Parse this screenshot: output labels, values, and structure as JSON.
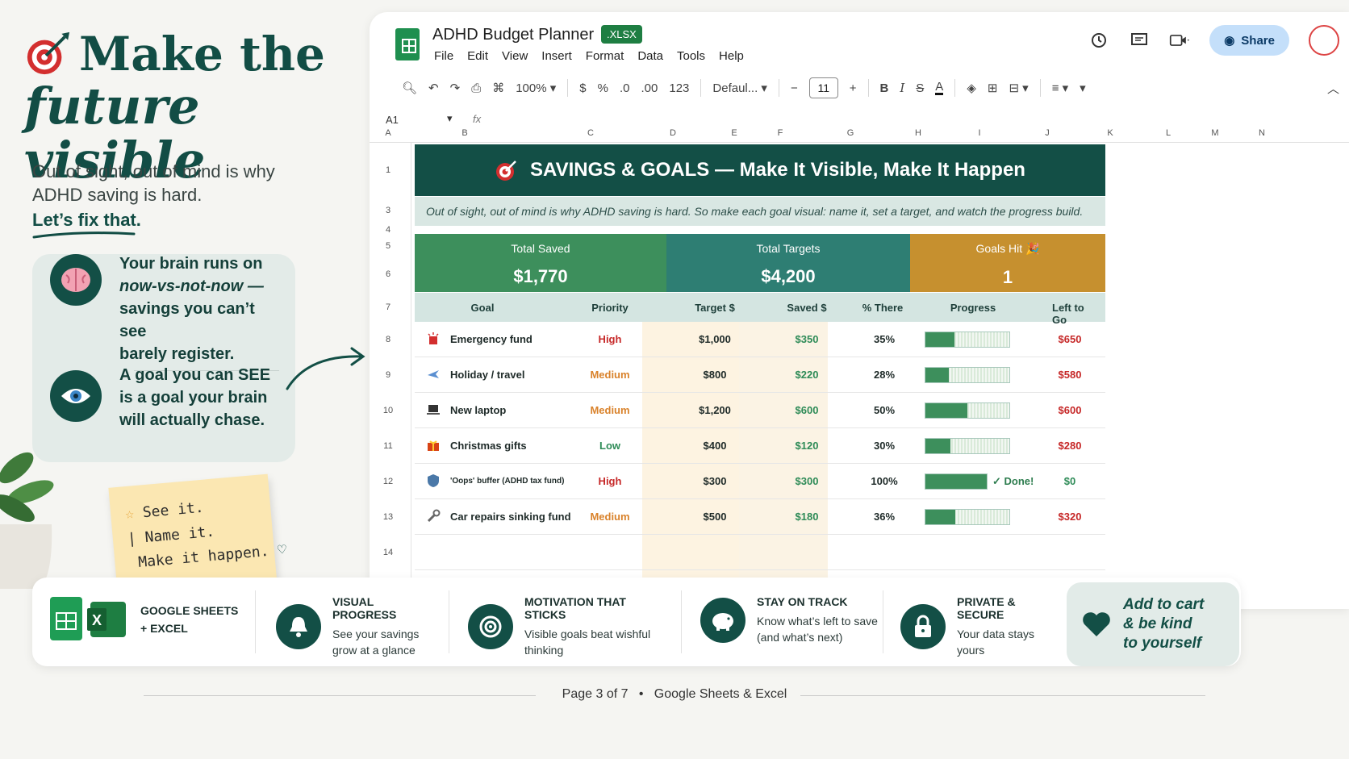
{
  "hero": {
    "title_line1": "Make the",
    "title_line2": "future visible",
    "subtitle": "Out of sight, out of mind is why ADHD saving is hard.",
    "fix": "Let’s fix that."
  },
  "brain_card": {
    "point1_line1": "Your brain runs on",
    "point1_line2": "now-vs-not-now —",
    "point1_line3": "savings you can’t see",
    "point1_line4": "barely register.",
    "point2_line1": "A goal you can SEE",
    "point2_line2": "is a goal your brain",
    "point2_line3": "will actually chase."
  },
  "sticky": {
    "line1": "See it.",
    "line2": "Name it.",
    "line3": "Make it happen."
  },
  "app": {
    "doc_title": "ADHD Budget Planner",
    "badge": ".XLSX",
    "menu": [
      "File",
      "Edit",
      "View",
      "Insert",
      "Format",
      "Data",
      "Tools",
      "Help"
    ],
    "share_label": "Share",
    "toolbar": {
      "zoom": "100%",
      "currency": "$",
      "percent": "%",
      "dec_less": ".0",
      "dec_more": ".00",
      "number_format": "123",
      "font": "Defaul...",
      "font_size": "11"
    },
    "cell_ref": "A1",
    "fx": "fx"
  },
  "columns": [
    "A",
    "B",
    "C",
    "D",
    "E",
    "F",
    "G",
    "H",
    "I",
    "J",
    "K",
    "L",
    "M",
    "N"
  ],
  "rows": [
    "1",
    "3",
    "4",
    "5",
    "6",
    "7",
    "8",
    "9",
    "10",
    "11",
    "12",
    "13",
    "14"
  ],
  "sheet": {
    "banner": "SAVINGS & GOALS — Make It Visible, Make It Happen",
    "subline": "Out of sight, out of mind is why ADHD saving is hard. So make each goal visual: name it, set a target, and watch the progress build.",
    "kpis": [
      {
        "label": "Total Saved",
        "value": "$1,770"
      },
      {
        "label": "Total Targets",
        "value": "$4,200"
      },
      {
        "label": "Goals Hit 🎉",
        "value": "1"
      }
    ],
    "headers": [
      "Goal",
      "Priority",
      "Target $",
      "Saved $",
      "% There",
      "Progress",
      "Left to Go"
    ],
    "goals": [
      {
        "name": "Emergency fund",
        "priority": "High",
        "target": "$1,000",
        "saved": "$350",
        "pct": "35%",
        "progress": 0.35,
        "left": "$650",
        "done": ""
      },
      {
        "name": "Holiday / travel",
        "priority": "Medium",
        "target": "$800",
        "saved": "$220",
        "pct": "28%",
        "progress": 0.28,
        "left": "$580",
        "done": ""
      },
      {
        "name": "New laptop",
        "priority": "Medium",
        "target": "$1,200",
        "saved": "$600",
        "pct": "50%",
        "progress": 0.5,
        "left": "$600",
        "done": ""
      },
      {
        "name": "Christmas gifts",
        "priority": "Low",
        "target": "$400",
        "saved": "$120",
        "pct": "30%",
        "progress": 0.3,
        "left": "$280",
        "done": ""
      },
      {
        "name": "'Oops' buffer (ADHD tax fund)",
        "priority": "High",
        "target": "$300",
        "saved": "$300",
        "pct": "100%",
        "progress": 1.0,
        "left": "$0",
        "done": "✓ Done!"
      },
      {
        "name": "Car repairs sinking fund",
        "priority": "Medium",
        "target": "$500",
        "saved": "$180",
        "pct": "36%",
        "progress": 0.36,
        "left": "$320",
        "done": ""
      }
    ]
  },
  "features": [
    {
      "title": "GOOGLE SHEETS",
      "desc": "+ EXCEL"
    },
    {
      "title": "VISUAL PROGRESS",
      "desc": "See your savings grow at a glance"
    },
    {
      "title": "MOTIVATION THAT STICKS",
      "desc": "Visible goals beat wishful thinking"
    },
    {
      "title": "STAY ON TRACK",
      "desc": "Know what’s left to save (and what’s next)"
    },
    {
      "title": "PRIVATE & SECURE",
      "desc": "Your data stays yours"
    }
  ],
  "cart": {
    "line1": "Add to cart",
    "line2": "& be kind",
    "line3": "to yourself"
  },
  "footer": {
    "page": "Page 3 of 7",
    "sep": "•",
    "platforms": "Google Sheets & Excel"
  },
  "colors": {
    "primary": "#134f46",
    "kpi_saved": "#3d8f5c",
    "kpi_targets": "#2e7e73",
    "kpi_goals": "#c6902f",
    "high": "#c62828",
    "medium": "#d9822b",
    "low": "#2e8b57",
    "saved": "#2e8b57"
  }
}
